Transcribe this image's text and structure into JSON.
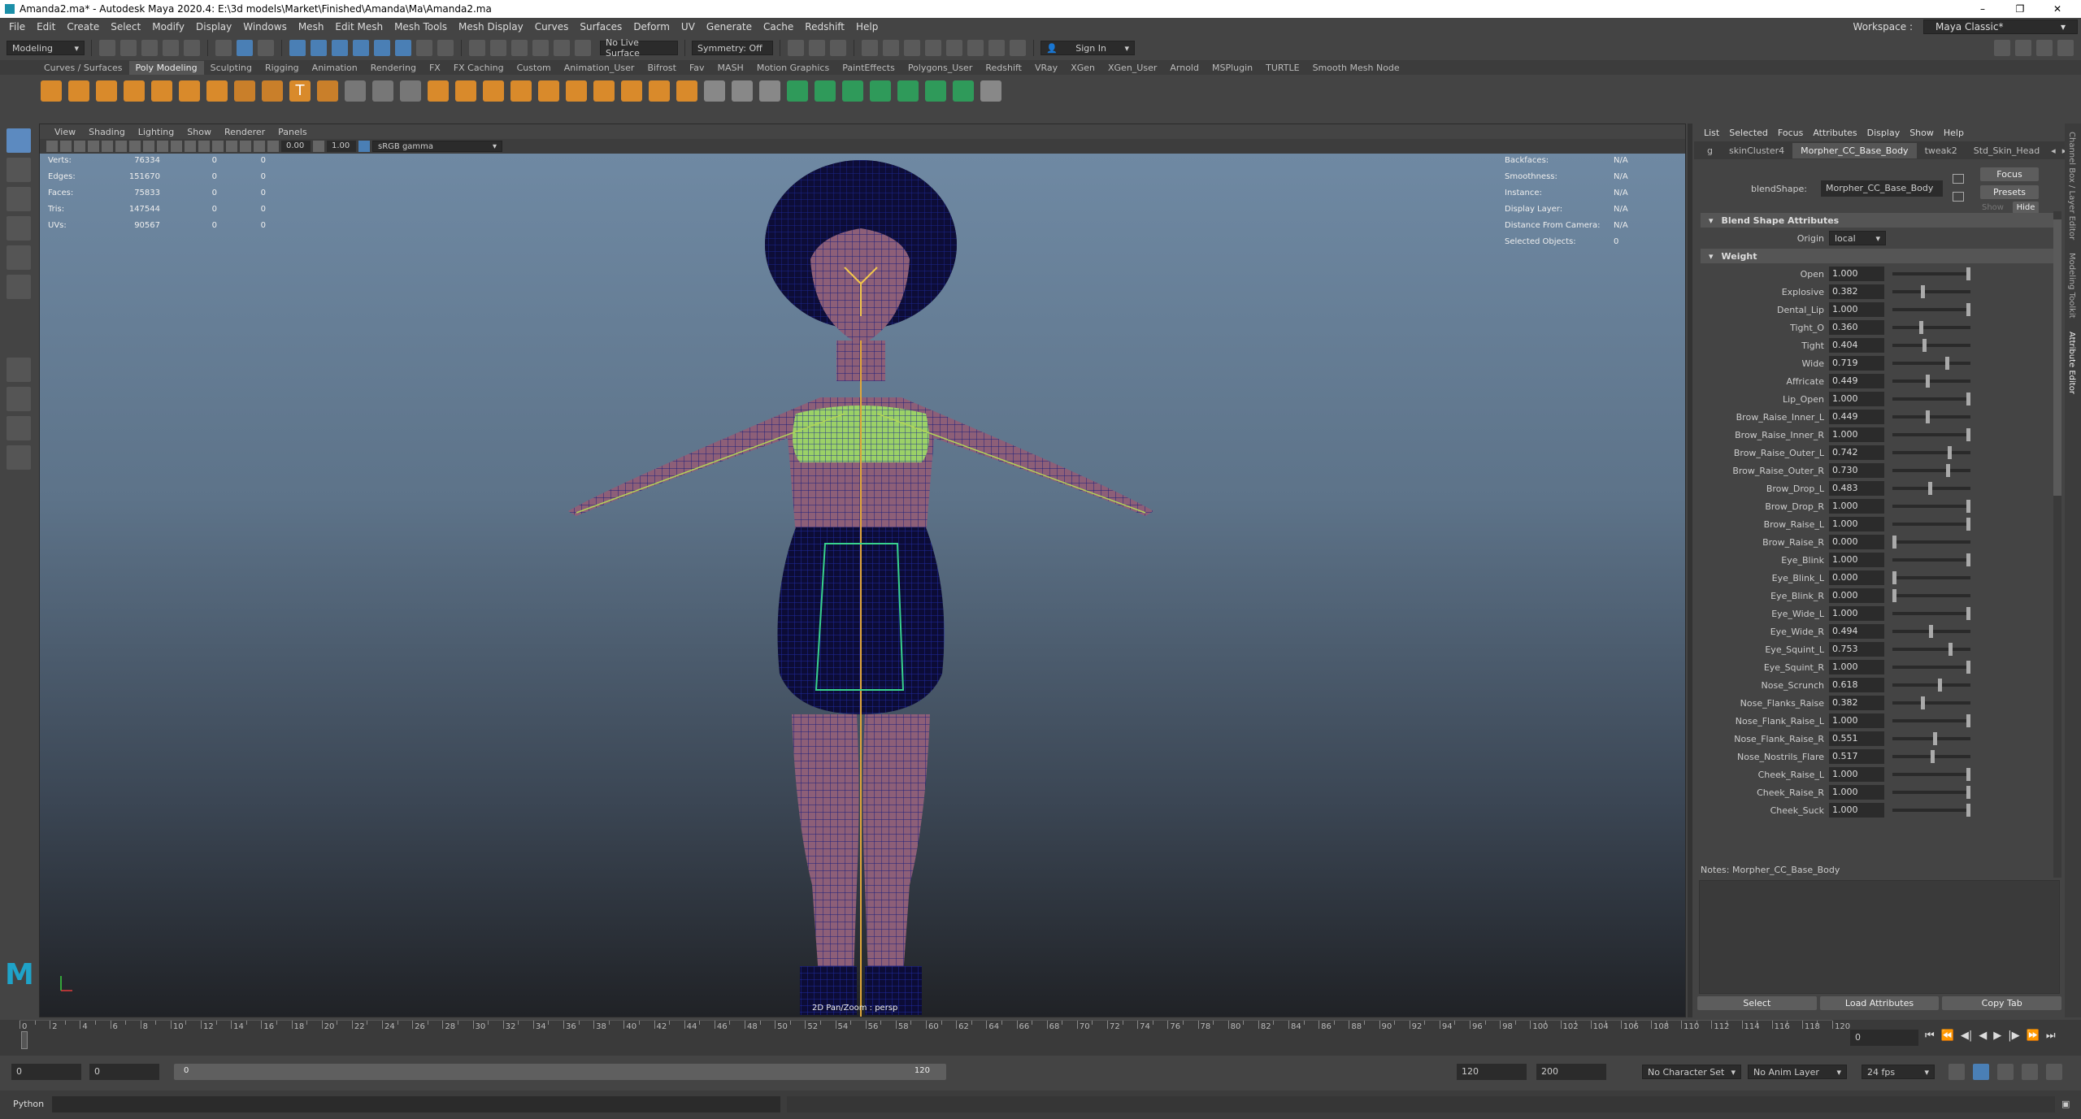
{
  "window": {
    "title": "Amanda2.ma* - Autodesk Maya 2020.4: E:\\3d models\\Market\\Finished\\Amanda\\Ma\\Amanda2.ma",
    "controls": [
      "–",
      "❐",
      "✕"
    ]
  },
  "menubar": {
    "items": [
      "File",
      "Edit",
      "Create",
      "Select",
      "Modify",
      "Display",
      "Windows",
      "Mesh",
      "Edit Mesh",
      "Mesh Tools",
      "Mesh Display",
      "Curves",
      "Surfaces",
      "Deform",
      "UV",
      "Generate",
      "Cache",
      "Redshift",
      "Help"
    ],
    "workspace_label": "Workspace :",
    "workspace_value": "Maya Classic*"
  },
  "statusline": {
    "mode": "Modeling",
    "live_surface": "No Live Surface",
    "symmetry": "Symmetry: Off",
    "sign_in": "Sign In"
  },
  "shelf": {
    "tabs": [
      "Curves / Surfaces",
      "Poly Modeling",
      "Sculpting",
      "Rigging",
      "Animation",
      "Rendering",
      "FX",
      "FX Caching",
      "Custom",
      "Animation_User",
      "Bifrost",
      "Fav",
      "MASH",
      "Motion Graphics",
      "PaintEffects",
      "Polygons_User",
      "Redshift",
      "VRay",
      "XGen",
      "XGen_User",
      "Arnold",
      "MSPlugin",
      "TURTLE",
      "Smooth Mesh Node"
    ],
    "active": "Poly Modeling"
  },
  "viewport": {
    "menu": [
      "View",
      "Shading",
      "Lighting",
      "Show",
      "Renderer",
      "Panels"
    ],
    "exposure": "0.00",
    "gamma": "1.00",
    "colorspace": "sRGB gamma",
    "camera_label": "2D Pan/Zoom : persp",
    "hud_left": [
      {
        "k": "Verts:",
        "a": "76334",
        "b": "0",
        "c": "0"
      },
      {
        "k": "Edges:",
        "a": "151670",
        "b": "0",
        "c": "0"
      },
      {
        "k": "Faces:",
        "a": "75833",
        "b": "0",
        "c": "0"
      },
      {
        "k": "Tris:",
        "a": "147544",
        "b": "0",
        "c": "0"
      },
      {
        "k": "UVs:",
        "a": "90567",
        "b": "0",
        "c": "0"
      }
    ],
    "hud_right": [
      {
        "k": "Backfaces:",
        "v": "N/A"
      },
      {
        "k": "Smoothness:",
        "v": "N/A"
      },
      {
        "k": "Instance:",
        "v": "N/A"
      },
      {
        "k": "Display Layer:",
        "v": "N/A"
      },
      {
        "k": "Distance From Camera:",
        "v": "N/A"
      },
      {
        "k": "Selected Objects:",
        "v": "0"
      }
    ]
  },
  "attr_editor": {
    "menu": [
      "List",
      "Selected",
      "Focus",
      "Attributes",
      "Display",
      "Show",
      "Help"
    ],
    "tabs": [
      "g",
      "skinCluster4",
      "Morpher_CC_Base_Body",
      "tweak2",
      "Std_Skin_Head"
    ],
    "active_tab": "Morpher_CC_Base_Body",
    "node_label": "blendShape:",
    "node_value": "Morpher_CC_Base_Body",
    "focus": "Focus",
    "presets": "Presets",
    "show": "Show",
    "hide": "Hide",
    "section1": "Blend Shape Attributes",
    "origin_label": "Origin",
    "origin_value": "local",
    "section2": "Weight",
    "weights": [
      {
        "name": "Open",
        "value": "1.000",
        "f": 1.0
      },
      {
        "name": "Explosive",
        "value": "0.382",
        "f": 0.382
      },
      {
        "name": "Dental_Lip",
        "value": "1.000",
        "f": 1.0
      },
      {
        "name": "Tight_O",
        "value": "0.360",
        "f": 0.36
      },
      {
        "name": "Tight",
        "value": "0.404",
        "f": 0.404
      },
      {
        "name": "Wide",
        "value": "0.719",
        "f": 0.719
      },
      {
        "name": "Affricate",
        "value": "0.449",
        "f": 0.449
      },
      {
        "name": "Lip_Open",
        "value": "1.000",
        "f": 1.0
      },
      {
        "name": "Brow_Raise_Inner_L",
        "value": "0.449",
        "f": 0.449
      },
      {
        "name": "Brow_Raise_Inner_R",
        "value": "1.000",
        "f": 1.0
      },
      {
        "name": "Brow_Raise_Outer_L",
        "value": "0.742",
        "f": 0.742
      },
      {
        "name": "Brow_Raise_Outer_R",
        "value": "0.730",
        "f": 0.73
      },
      {
        "name": "Brow_Drop_L",
        "value": "0.483",
        "f": 0.483
      },
      {
        "name": "Brow_Drop_R",
        "value": "1.000",
        "f": 1.0
      },
      {
        "name": "Brow_Raise_L",
        "value": "1.000",
        "f": 1.0
      },
      {
        "name": "Brow_Raise_R",
        "value": "0.000",
        "f": 0.0
      },
      {
        "name": "Eye_Blink",
        "value": "1.000",
        "f": 1.0
      },
      {
        "name": "Eye_Blink_L",
        "value": "0.000",
        "f": 0.0
      },
      {
        "name": "Eye_Blink_R",
        "value": "0.000",
        "f": 0.0
      },
      {
        "name": "Eye_Wide_L",
        "value": "1.000",
        "f": 1.0
      },
      {
        "name": "Eye_Wide_R",
        "value": "0.494",
        "f": 0.494
      },
      {
        "name": "Eye_Squint_L",
        "value": "0.753",
        "f": 0.753
      },
      {
        "name": "Eye_Squint_R",
        "value": "1.000",
        "f": 1.0
      },
      {
        "name": "Nose_Scrunch",
        "value": "0.618",
        "f": 0.618
      },
      {
        "name": "Nose_Flanks_Raise",
        "value": "0.382",
        "f": 0.382
      },
      {
        "name": "Nose_Flank_Raise_L",
        "value": "1.000",
        "f": 1.0
      },
      {
        "name": "Nose_Flank_Raise_R",
        "value": "0.551",
        "f": 0.551
      },
      {
        "name": "Nose_Nostrils_Flare",
        "value": "0.517",
        "f": 0.517
      },
      {
        "name": "Cheek_Raise_L",
        "value": "1.000",
        "f": 1.0
      },
      {
        "name": "Cheek_Raise_R",
        "value": "1.000",
        "f": 1.0
      },
      {
        "name": "Cheek_Suck",
        "value": "1.000",
        "f": 1.0
      }
    ],
    "notes_label": "Notes:",
    "notes_value": "Morpher_CC_Base_Body",
    "btn_select": "Select",
    "btn_load": "Load Attributes",
    "btn_copy": "Copy Tab"
  },
  "side_tabs": [
    "Channel Box / Layer Editor",
    "Modeling Toolkit",
    "Attribute Editor"
  ],
  "timeline": {
    "ticks": [
      "0",
      "2",
      "4",
      "6",
      "8",
      "10",
      "12",
      "14",
      "16",
      "18",
      "20",
      "22",
      "24",
      "26",
      "28",
      "30",
      "32",
      "34",
      "36",
      "38",
      "40",
      "42",
      "44",
      "46",
      "48",
      "50",
      "52",
      "54",
      "56",
      "58",
      "60",
      "62",
      "64",
      "66",
      "68",
      "70",
      "72",
      "74",
      "76",
      "78",
      "80",
      "82",
      "84",
      "86",
      "88",
      "90",
      "92",
      "94",
      "96",
      "98",
      "100",
      "102",
      "104",
      "106",
      "108",
      "110",
      "112",
      "114",
      "116",
      "118",
      "120"
    ],
    "current": "0"
  },
  "range": {
    "start": "0",
    "start2": "0",
    "slider_start": "0",
    "slider_end": "120",
    "end": "120",
    "end2": "200",
    "char_set": "No Character Set",
    "anim_layer": "No Anim Layer",
    "fps": "24 fps"
  },
  "cmdline": {
    "lang": "Python"
  }
}
